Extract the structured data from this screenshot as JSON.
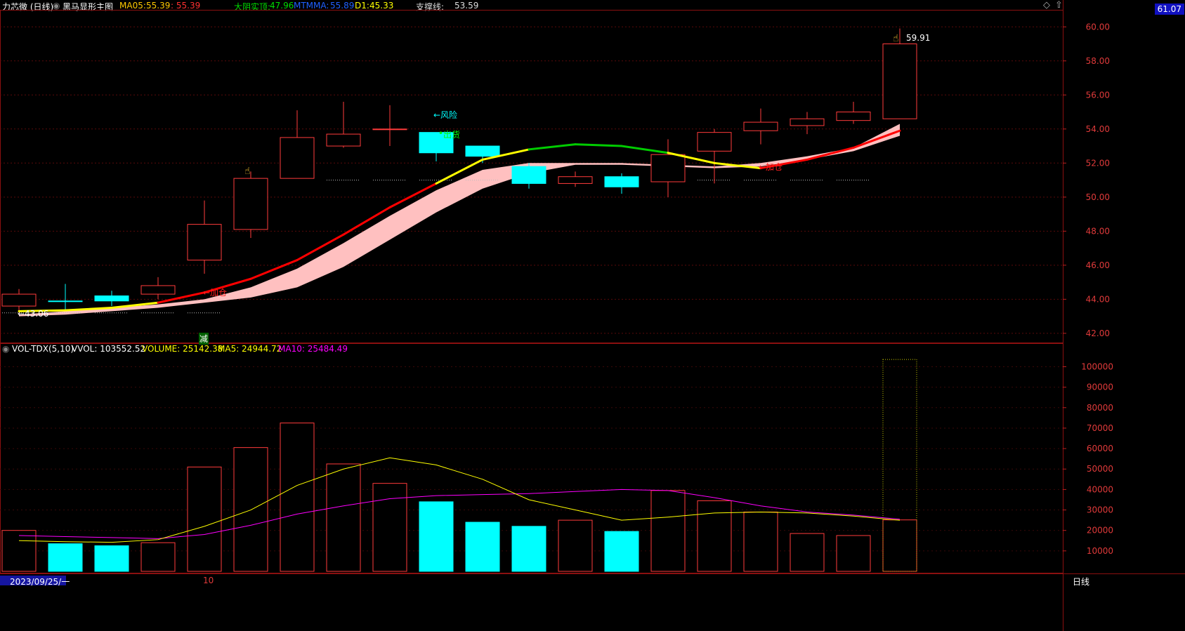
{
  "header": {
    "stock_name": "力芯微 (日线)",
    "indicator_name": "黑马显形主图",
    "ma05_label": "MA05:",
    "ma05_value": "55.39",
    "ma05_value2": ": 55.39",
    "dayin_label": "大阴实顶:",
    "dayin_value": "47.96",
    "mtmma_label": "MTMMA:",
    "mtmma_value": "55.89",
    "d1_label": "D1:",
    "d1_value": "45.33",
    "support_label": "支撑线:",
    "support_value": "53.59"
  },
  "vol_header": {
    "name": "VOL-TDX(5,10)",
    "vvol": "VVOL: 103552.52",
    "volume": "VOLUME: 25142.38",
    "ma5": "MA5: 24944.72",
    "ma10": "MA10: 25484.49"
  },
  "price_badge": "61.07",
  "annotations": {
    "risk": "←风险",
    "chuhuo": "出货",
    "jiacang_1": "←加仓",
    "jiacang_2": "←加仓",
    "low_price": "←43.06",
    "high_price": "59.91",
    "jian": "减"
  },
  "bottom": {
    "date": "2023/09/25/一",
    "month": "10",
    "period": "日线"
  },
  "colors": {
    "up": "#ff3b3b",
    "down": "#00ffff",
    "ma_red": "#ff0000",
    "band": "#ffc0c0",
    "yellow": "#ffff00",
    "magenta": "#ff00ff",
    "green": "#00cc00"
  },
  "chart_data": [
    {
      "type": "candlestick",
      "title": "黑马显形主图",
      "y_ticks": [
        "60.00",
        "58.00",
        "56.00",
        "54.00",
        "52.00",
        "50.00",
        "48.00",
        "46.00",
        "44.00",
        "42.00"
      ],
      "ylim": [
        41.5,
        61.0
      ],
      "candles": [
        {
          "o": 43.6,
          "c": 44.3,
          "h": 44.6,
          "l": 43.2,
          "up": true
        },
        {
          "o": 43.9,
          "c": 43.9,
          "h": 44.9,
          "l": 43.3,
          "up": false
        },
        {
          "o": 44.2,
          "c": 43.9,
          "h": 44.5,
          "l": 43.6,
          "up": false
        },
        {
          "o": 44.3,
          "c": 44.8,
          "h": 45.3,
          "l": 44.0,
          "up": true
        },
        {
          "o": 46.3,
          "c": 48.4,
          "h": 49.8,
          "l": 45.5,
          "up": true
        },
        {
          "o": 48.1,
          "c": 51.1,
          "h": 51.5,
          "l": 47.6,
          "up": true
        },
        {
          "o": 51.1,
          "c": 53.5,
          "h": 55.1,
          "l": 51.1,
          "up": true
        },
        {
          "o": 53.0,
          "c": 53.7,
          "h": 55.6,
          "l": 52.9,
          "up": true
        },
        {
          "o": 54.0,
          "c": 54.0,
          "h": 55.4,
          "l": 53.0,
          "up": true
        },
        {
          "o": 53.8,
          "c": 52.6,
          "h": 53.8,
          "l": 52.1,
          "up": false
        },
        {
          "o": 53.0,
          "c": 52.4,
          "h": 53.0,
          "l": 52.0,
          "up": false
        },
        {
          "o": 51.8,
          "c": 50.8,
          "h": 52.0,
          "l": 50.5,
          "up": false
        },
        {
          "o": 50.8,
          "c": 51.2,
          "h": 51.5,
          "l": 50.6,
          "up": true
        },
        {
          "o": 51.2,
          "c": 50.6,
          "h": 51.4,
          "l": 50.2,
          "up": false
        },
        {
          "o": 50.9,
          "c": 52.5,
          "h": 53.4,
          "l": 50.0,
          "up": true
        },
        {
          "o": 52.7,
          "c": 53.8,
          "h": 54.0,
          "l": 50.8,
          "up": true
        },
        {
          "o": 53.9,
          "c": 54.4,
          "h": 55.2,
          "l": 53.1,
          "up": true
        },
        {
          "o": 54.2,
          "c": 54.6,
          "h": 55.0,
          "l": 53.7,
          "up": true
        },
        {
          "o": 54.5,
          "c": 55.0,
          "h": 55.6,
          "l": 54.3,
          "up": true
        },
        {
          "o": 54.6,
          "c": 59.0,
          "h": 59.91,
          "l": 54.6,
          "up": true
        }
      ],
      "ma05": [
        43.3,
        43.35,
        43.5,
        43.8,
        44.4,
        45.2,
        46.3,
        47.8,
        49.4,
        50.8,
        52.2,
        52.8,
        53.1,
        53.0,
        52.6,
        52.0,
        51.7,
        52.2,
        52.9,
        53.9
      ],
      "band_upper": [
        43.1,
        43.3,
        43.5,
        43.7,
        44.0,
        44.7,
        45.8,
        47.3,
        48.9,
        50.4,
        51.6,
        52.0,
        52.0,
        52.0,
        51.9,
        51.8,
        52.0,
        52.4,
        52.9,
        54.3
      ],
      "band_lower": [
        43.0,
        43.1,
        43.3,
        43.5,
        43.8,
        44.1,
        44.7,
        45.9,
        47.5,
        49.1,
        50.5,
        51.4,
        51.9,
        51.9,
        51.8,
        51.7,
        51.8,
        52.2,
        52.7,
        53.6
      ],
      "support_levels": [
        43.2,
        43.2,
        43.2,
        43.2,
        43.2,
        null,
        null,
        51.0,
        51.0,
        51.0,
        51.0,
        51.0,
        51.0,
        51.0,
        51.0,
        51.0,
        51.0,
        51.0,
        51.0,
        null
      ]
    },
    {
      "type": "bar",
      "title": "VOL-TDX(5,10)",
      "y_ticks": [
        "100000",
        "90000",
        "80000",
        "70000",
        "60000",
        "50000",
        "40000",
        "30000",
        "20000",
        "10000"
      ],
      "ylim": [
        0,
        106000
      ],
      "values": [
        20000,
        13500,
        12500,
        14000,
        51000,
        60500,
        72500,
        52500,
        43000,
        34000,
        24000,
        22000,
        25000,
        19500,
        39500,
        34500,
        29000,
        18500,
        17500,
        25142
      ],
      "up": [
        true,
        false,
        false,
        true,
        true,
        true,
        true,
        true,
        true,
        false,
        false,
        false,
        true,
        false,
        true,
        true,
        true,
        true,
        true,
        true
      ],
      "vvol": 103552.52,
      "ma5": [
        15000,
        14500,
        14200,
        15500,
        22000,
        30000,
        42000,
        50000,
        55500,
        52000,
        45000,
        35000,
        30000,
        25000,
        26500,
        28500,
        29000,
        28500,
        27000,
        24945
      ],
      "ma10": [
        17500,
        17000,
        16500,
        16000,
        18000,
        22500,
        28000,
        32000,
        35500,
        37000,
        37500,
        38000,
        39000,
        40000,
        39500,
        36000,
        32000,
        29000,
        27500,
        25484
      ]
    }
  ]
}
